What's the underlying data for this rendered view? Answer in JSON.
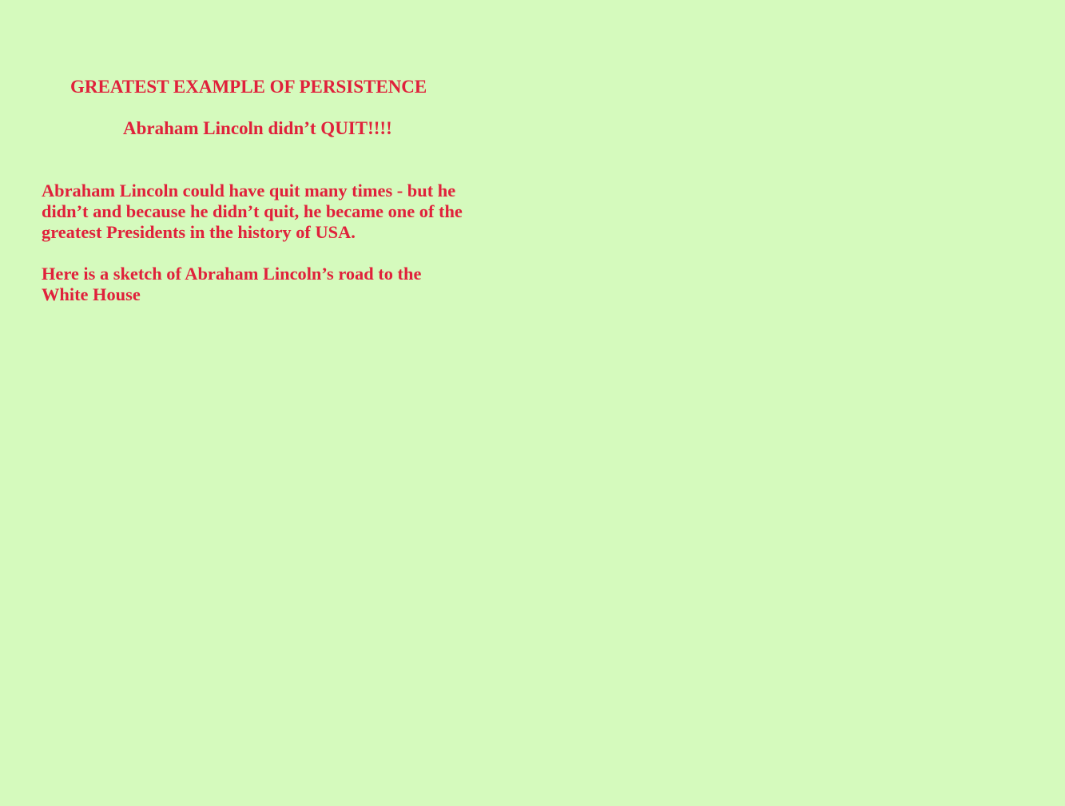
{
  "document": {
    "title": "GREATEST EXAMPLE OF PERSISTENCE",
    "subtitle": "Abraham Lincoln didn’t QUIT!!!!",
    "paragraphs": [
      "Abraham Lincoln could have quit many times - but he didn’t and because he didn’t quit, he became one of the greatest Presidents in the history of USA.",
      "Here is a sketch of Abraham Lincoln’s road to the White House"
    ]
  },
  "colors": {
    "background": "#d5fabd",
    "text": "#e0213b"
  }
}
